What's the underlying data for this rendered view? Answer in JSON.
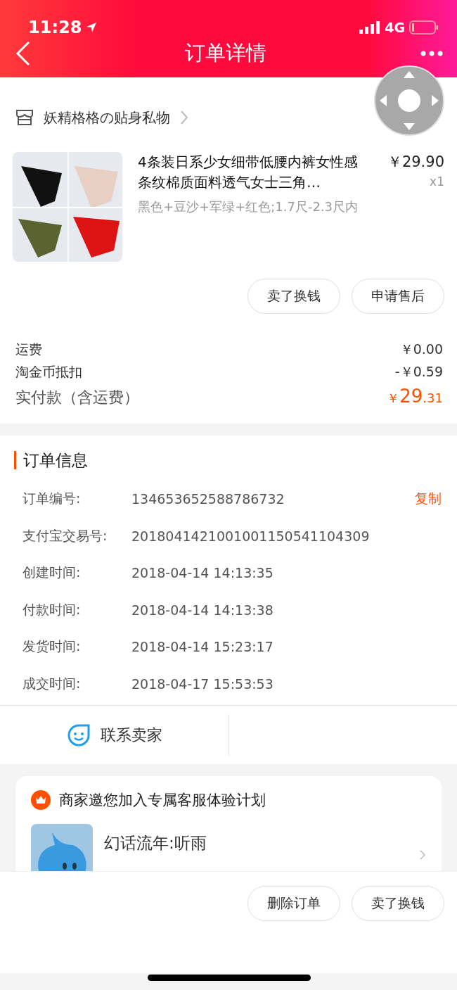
{
  "status_bar": {
    "time": "11:28",
    "network": "4G"
  },
  "nav": {
    "title": "订单详情"
  },
  "shop": {
    "name": "妖精格格の贴身私物"
  },
  "product": {
    "kind": "picture",
    "title": "4条装日系少女细带低腰内裤女性感条纹棉质面料透气女士三角…",
    "price": "￥29.90",
    "quantity": "x1",
    "sku": "黑色+豆沙+军绿+红色;1.7尺-2.3尺内"
  },
  "product_buttons": [
    "卖了换钱",
    "申请售后"
  ],
  "fees": [
    {
      "label": "运费",
      "value": "￥0.00"
    },
    {
      "label": "淘金币抵扣",
      "value": "-￥0.59"
    }
  ],
  "total": {
    "label": "实付款（含运费）",
    "currency": "￥",
    "integer": "29",
    "decimal": ".31"
  },
  "order_info": {
    "title": "订单信息",
    "copy": "复制",
    "rows": [
      {
        "label": "订单编号:",
        "value": "134653652588786732"
      },
      {
        "label": "支付宝交易号:",
        "value": "2018041421001001150541104309"
      },
      {
        "label": "创建时间:",
        "value": "2018-04-14 14:13:35"
      },
      {
        "label": "付款时间:",
        "value": "2018-04-14 14:13:38"
      },
      {
        "label": "发货时间:",
        "value": "2018-04-14 15:23:17"
      },
      {
        "label": "成交时间:",
        "value": "2018-04-17 15:53:53"
      }
    ]
  },
  "contact": {
    "label": "联系卖家"
  },
  "invite": {
    "title": "商家邀您加入专属客服体验计划",
    "agent": "幻话流年:听雨"
  },
  "bottom_buttons": [
    "删除订单",
    "卖了换钱"
  ]
}
